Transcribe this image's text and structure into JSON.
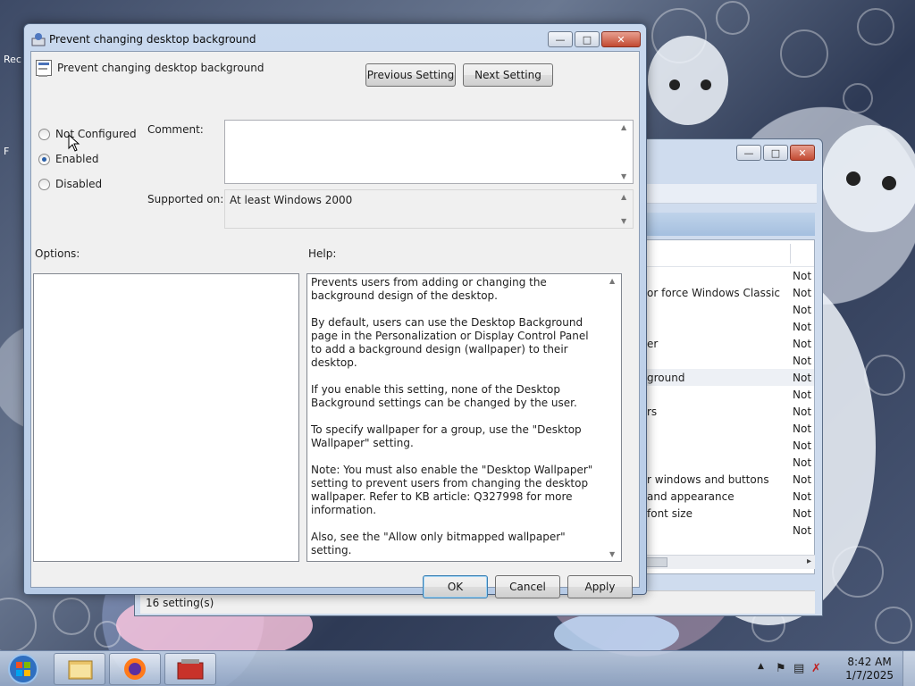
{
  "dialog": {
    "title": "Prevent changing desktop background",
    "header_title": "Prevent changing desktop background",
    "prev_button": "Previous Setting",
    "next_button": "Next Setting",
    "options": [
      {
        "label": "Not Configured",
        "checked": false
      },
      {
        "label": "Enabled",
        "checked": true
      },
      {
        "label": "Disabled",
        "checked": false
      }
    ],
    "comment_label": "Comment:",
    "comment_value": "",
    "supported_label": "Supported on:",
    "supported_value": "At least Windows 2000",
    "options_label": "Options:",
    "help_label": "Help:",
    "help_paragraphs": [
      "Prevents users from adding or changing the background design of the desktop.",
      "By default, users can use the Desktop Background page in the Personalization or Display Control Panel to add a background design (wallpaper) to their desktop.",
      "If you enable this setting, none of the Desktop Background settings can be changed by the user.",
      "To specify wallpaper for a group, use the \"Desktop Wallpaper\" setting.",
      "Note: You must also enable the \"Desktop Wallpaper\" setting to prevent users from changing the desktop wallpaper. Refer to KB article: Q327998 for more information.",
      "Also, see the \"Allow only bitmapped wallpaper\" setting."
    ],
    "ok_button": "OK",
    "cancel_button": "Cancel",
    "apply_button": "Apply"
  },
  "background_window": {
    "status_text": "16 setting(s)",
    "rows": [
      {
        "name": "",
        "state": "Not",
        "selected": false
      },
      {
        "name": "or force Windows Classic",
        "state": "Not",
        "selected": false
      },
      {
        "name": "",
        "state": "Not",
        "selected": false
      },
      {
        "name": "",
        "state": "Not",
        "selected": false
      },
      {
        "name": "er",
        "state": "Not",
        "selected": false
      },
      {
        "name": "",
        "state": "Not",
        "selected": false
      },
      {
        "name": "ground",
        "state": "Not",
        "selected": true
      },
      {
        "name": "",
        "state": "Not",
        "selected": false
      },
      {
        "name": "rs",
        "state": "Not",
        "selected": false
      },
      {
        "name": "",
        "state": "Not",
        "selected": false
      },
      {
        "name": "",
        "state": "Not",
        "selected": false
      },
      {
        "name": "",
        "state": "Not",
        "selected": false
      },
      {
        "name": "r windows and buttons",
        "state": "Not",
        "selected": false
      },
      {
        "name": "and appearance",
        "state": "Not",
        "selected": false
      },
      {
        "name": "font size",
        "state": "Not",
        "selected": false
      },
      {
        "name": "",
        "state": "Not",
        "selected": false
      }
    ]
  },
  "desktop": {
    "icon_labels": [
      "Rec",
      "F"
    ]
  },
  "taskbar": {
    "clock_time": "8:42 AM",
    "clock_date": "1/7/2025",
    "items": [
      "explorer-icon",
      "firefox-icon",
      "toolbox-icon"
    ]
  },
  "colors": {
    "accent": "#3c7fb1",
    "radio_dot": "#2a5fa8",
    "title_bar": "#c9d9ee"
  }
}
